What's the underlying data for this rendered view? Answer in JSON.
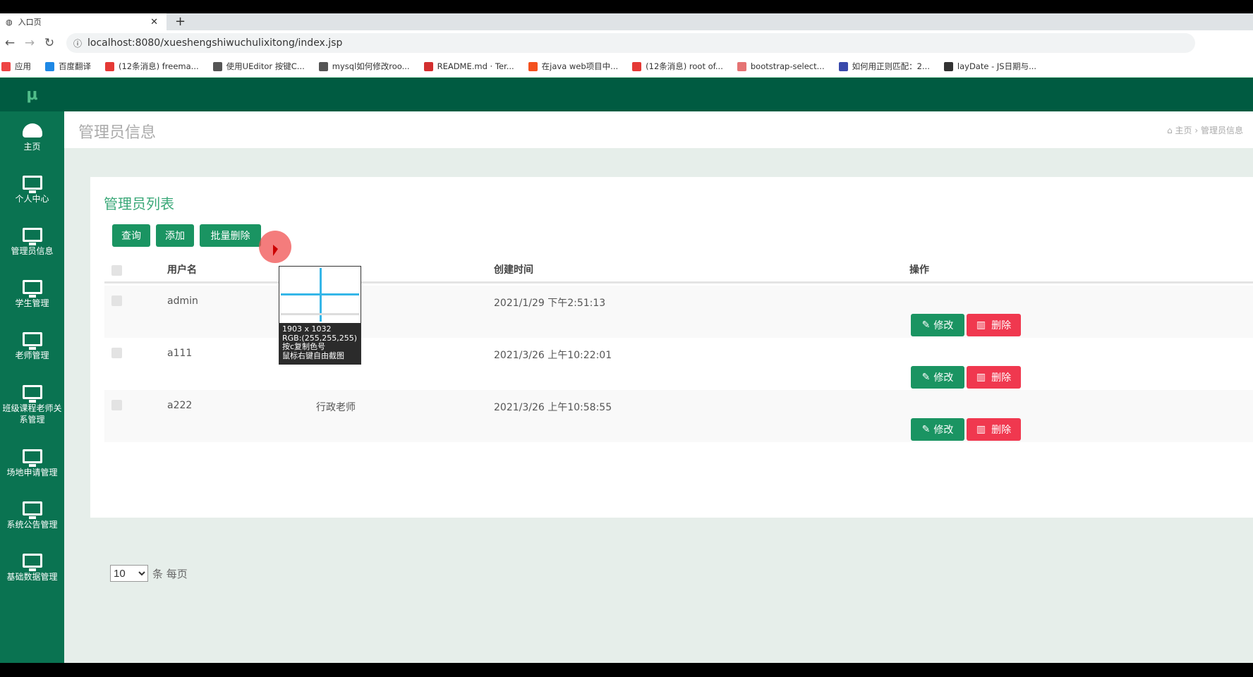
{
  "browser": {
    "tab_title": "入口页",
    "url": "localhost:8080/xueshengshiwuchulixitong/index.jsp",
    "bookmarks": [
      "应用",
      "百度翻译",
      "(12条消息) freema...",
      "使用UEditor 按键C...",
      "mysql如何修改roo...",
      "README.md · Ter...",
      "在java web项目中...",
      "(12条消息) root of...",
      "bootstrap-select...",
      "如何用正则匹配：2...",
      "layDate - JS日期与..."
    ],
    "bookmark_colors": [
      "#e44",
      "#1e88e5",
      "#e53935",
      "#555",
      "#555",
      "#d32f2f",
      "#f4511e",
      "#e53935",
      "#e57373",
      "#3949ab",
      "#333"
    ]
  },
  "colors": {
    "header": "#005b41",
    "sidebar": "#0a7351",
    "primary": "#1a9462",
    "danger": "#f0384f"
  },
  "logo": "μ",
  "sidebar": {
    "items": [
      {
        "label": "主页",
        "icon": "dashboard-icon"
      },
      {
        "label": "个人中心",
        "icon": "monitor-icon"
      },
      {
        "label": "管理员信息",
        "icon": "monitor-icon"
      },
      {
        "label": "学生管理",
        "icon": "monitor-icon"
      },
      {
        "label": "老师管理",
        "icon": "monitor-icon"
      },
      {
        "label": "班级课程老师关系管理",
        "icon": "monitor-icon"
      },
      {
        "label": "场地申请管理",
        "icon": "monitor-icon"
      },
      {
        "label": "系统公告管理",
        "icon": "monitor-icon"
      },
      {
        "label": "基础数据管理",
        "icon": "monitor-icon"
      }
    ]
  },
  "page": {
    "title": "管理员信息",
    "breadcrumb": [
      "主页",
      "管理员信息"
    ]
  },
  "card": {
    "title": "管理员列表",
    "buttons": {
      "query": "查询",
      "add": "添加",
      "batch_delete": "批量删除"
    },
    "table": {
      "headers": [
        "用户名",
        "",
        "创建时间",
        "操作"
      ],
      "rows": [
        {
          "username": "admin",
          "role": "",
          "created": "2021/1/29 下午2:51:13"
        },
        {
          "username": "a111",
          "role": "",
          "created": "2021/3/26 上午10:22:01"
        },
        {
          "username": "a222",
          "role": "行政老师",
          "created": "2021/3/26 上午10:58:55"
        }
      ],
      "edit_label": "修改",
      "delete_label": "删除"
    },
    "pager": {
      "page_size": "10",
      "suffix": "条 每页"
    }
  },
  "color_picker_popup": {
    "size": "1903 x 1032",
    "rgb": "RGB:(255,255,255)",
    "hint1": "按c复制色号",
    "hint2": "鼠标右键自由截图"
  }
}
